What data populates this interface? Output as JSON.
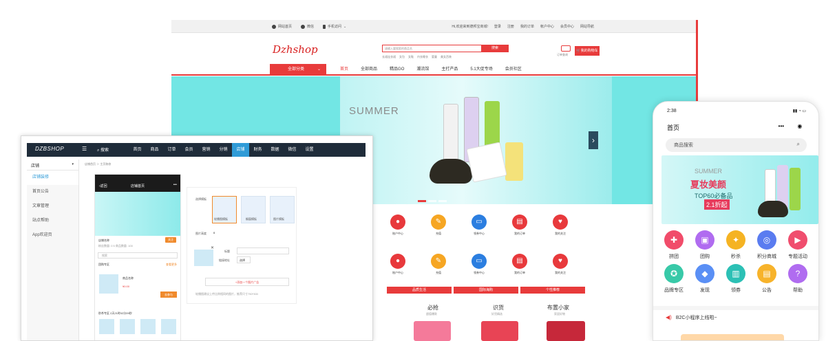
{
  "store": {
    "topbar_left": [
      "网站首页",
      "微信",
      "手机访问"
    ],
    "topbar_right": [
      "Hi,欢迎来到德邦宝商城!",
      "登录",
      "注册",
      "我的订单",
      "帐户中心",
      "会员中心",
      "网站导航"
    ],
    "logo": "Dzhshop",
    "search_placeholder": "请输入要搜索的商品名",
    "search_button": "搜索",
    "hot_words": [
      "长裙连衣裙",
      "女包",
      "女鞋",
      "内衣睡衣",
      "婴童",
      "美女西装"
    ],
    "cart_label": "订单查询",
    "cart_button": "我的购物车",
    "category_button": "全部分类",
    "nav": [
      "首页",
      "全部商品",
      "精品GO",
      "潮流馆",
      "主打产品",
      "5.1大促专场",
      "会员社区"
    ],
    "hero_text": "SUMMER",
    "icons_row1": [
      {
        "label": "账户中心",
        "color": "#e8393c",
        "glyph": "●"
      },
      {
        "label": "充值",
        "color": "#f6a623",
        "glyph": "✎"
      },
      {
        "label": "领券中心",
        "color": "#2b7ee0",
        "glyph": "▭"
      },
      {
        "label": "我的订单",
        "color": "#e8393c",
        "glyph": "▤"
      },
      {
        "label": "我的关注",
        "color": "#e8393c",
        "glyph": "♥"
      }
    ],
    "icons_row2": [
      {
        "label": "账户中心",
        "color": "#e8393c",
        "glyph": "●"
      },
      {
        "label": "充值",
        "color": "#f6a623",
        "glyph": "✎"
      },
      {
        "label": "领券中心",
        "color": "#2b7ee0",
        "glyph": "▭"
      },
      {
        "label": "我的订单",
        "color": "#e8393c",
        "glyph": "▤"
      },
      {
        "label": "我的关注",
        "color": "#e8393c",
        "glyph": "♥"
      }
    ],
    "floors": [
      "品质生活",
      "国际海购",
      "个性推荐"
    ],
    "products": [
      {
        "title": "必抢",
        "sub": "超值爆款"
      },
      {
        "title": "识货",
        "sub": "好货精选"
      },
      {
        "title": "布置小家",
        "sub": "家居好物"
      }
    ]
  },
  "admin": {
    "logo": "DZBSHOP",
    "search": "搜索",
    "menu": [
      "首页",
      "商品",
      "订单",
      "会员",
      "营销",
      "分销",
      "店铺",
      "财务",
      "数据",
      "微信",
      "设置"
    ],
    "active_menu": "店铺",
    "side_header": "店铺",
    "side_items": [
      "店铺装修",
      "首页公告",
      "文章管理",
      "站点帮助",
      "App欢迎页"
    ],
    "breadcrumb": "店铺首页 ＞ 主页装修",
    "phone_title": "店铺首页",
    "phone_back": "返回",
    "shop_name": "店铺名称",
    "shop_stats": "粉丝数量: 0   5 商品数量: 100",
    "follow": "关注",
    "phone_search": "搜索",
    "section_group": "团购专区",
    "section_more": "查看更多",
    "product_name": "商品名称",
    "product_price": "¥0.00",
    "buy": "去参与",
    "section_seckill": "秒杀专区",
    "seckill_time": "2天21时02分09秒",
    "form_label_tpl": "选择模板",
    "tpl_names": [
      "轮播图模板",
      "橱窗模板",
      "图片模板"
    ],
    "form_label_height": "图片高度",
    "form_height_value": "0",
    "form_label_title": "标题",
    "form_label_link": "链接地址",
    "form_choose": "选择",
    "add_ad": "+添加一个图片广告",
    "hint": "轮播图建议上传比例相同的图片，推荐尺寸750*300"
  },
  "mobile": {
    "time": "2:38",
    "title": "首页",
    "search": "商品搜索",
    "banner_top": "SUMMER",
    "banner_head": "夏妆美颜",
    "banner_sub": "TOP60必备品",
    "banner_badge": "2.1折起",
    "row1": [
      {
        "label": "拼团",
        "color": "#f14c6a",
        "glyph": "✚"
      },
      {
        "label": "团购",
        "color": "#b06cf0",
        "glyph": "▣"
      },
      {
        "label": "秒杀",
        "color": "#f5b323",
        "glyph": "✦"
      },
      {
        "label": "积分商城",
        "color": "#5a7cf0",
        "glyph": "◎"
      },
      {
        "label": "专题活动",
        "color": "#f04e6e",
        "glyph": "▶"
      }
    ],
    "row2": [
      {
        "label": "品牌专区",
        "color": "#38c9a8",
        "glyph": "✪"
      },
      {
        "label": "发现",
        "color": "#5a8ff5",
        "glyph": "◆"
      },
      {
        "label": "领券",
        "color": "#2cc0b5",
        "glyph": "▥"
      },
      {
        "label": "公告",
        "color": "#f7b32b",
        "glyph": "▤"
      },
      {
        "label": "帮助",
        "color": "#b06cf0",
        "glyph": "?"
      }
    ],
    "notice": "B2C小程序上线啦~"
  }
}
